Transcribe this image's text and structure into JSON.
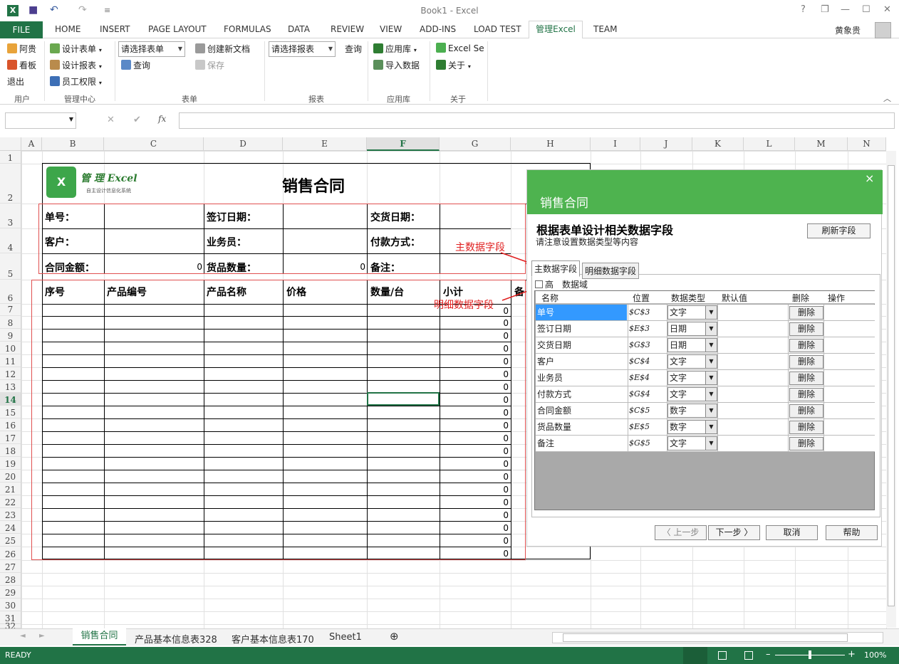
{
  "window": {
    "title": "Book1 - Excel",
    "help": "?",
    "restore_ribbon": "❐",
    "minimize": "—",
    "maximize": "☐",
    "close": "✕"
  },
  "qat": {
    "save": "■",
    "undo": "↶",
    "redo": "↷",
    "customize": "≡"
  },
  "tabs": {
    "file": "FILE",
    "home": "HOME",
    "insert": "INSERT",
    "page_layout": "PAGE LAYOUT",
    "formulas": "FORMULAS",
    "data": "DATA",
    "review": "REVIEW",
    "view": "VIEW",
    "add_ins": "ADD-INS",
    "load_test": "LOAD TEST",
    "manage_excel": "管理Excel",
    "team": "TEAM",
    "user": "黄象贵"
  },
  "ribbon": {
    "user_group": {
      "user": "阿贵",
      "dashboard": "看板",
      "logout": "退出",
      "label": "用户"
    },
    "mgmt_group": {
      "design_form": "设计表单",
      "design_report": "设计报表",
      "permissions": "员工权限",
      "label": "管理中心"
    },
    "form_group": {
      "select_form": "请选择表单",
      "query": "查询",
      "create_doc": "创建新文档",
      "save": "保存",
      "label": "表单"
    },
    "report_group": {
      "select_report": "请选择报表",
      "query": "查询",
      "label": "报表"
    },
    "app_group": {
      "app_lib": "应用库",
      "import": "导入数据",
      "label": "应用库"
    },
    "about_group": {
      "excel_se": "Excel Se",
      "about": "关于",
      "label": "关于"
    }
  },
  "formula_bar": {
    "cancel": "✕",
    "enter": "✔",
    "fx": "fx",
    "value": ""
  },
  "columns": [
    "A",
    "B",
    "C",
    "D",
    "E",
    "F",
    "G",
    "H",
    "I",
    "J",
    "K",
    "L",
    "M",
    "N"
  ],
  "rows": [
    "1",
    "2",
    "3",
    "4",
    "5",
    "6",
    "7",
    "8",
    "9",
    "10",
    "11",
    "12",
    "13",
    "14",
    "15",
    "16",
    "17",
    "18",
    "19",
    "20",
    "21",
    "22",
    "23",
    "24",
    "25",
    "26",
    "27",
    "28",
    "29",
    "30",
    "31",
    "32"
  ],
  "sheet": {
    "logo_title": "管 理 Excel",
    "logo_subtitle": "自主设计信息化系统",
    "title": "销售合同",
    "labels": {
      "order_no": "单号：",
      "sign_date": "签订日期：",
      "delivery_date": "交货日期：",
      "customer": "客户：",
      "salesman": "业务员：",
      "payment": "付款方式：",
      "amount": "合同金额：",
      "amount_val": "0",
      "qty": "货品数量：",
      "qty_val": "0",
      "remark": "备注："
    },
    "detail_headers": [
      "序号",
      "产品编号",
      "产品名称",
      "价格",
      "数量/台",
      "小计",
      "备"
    ],
    "subtotals": [
      "0",
      "0",
      "0",
      "0",
      "0",
      "0",
      "0",
      "0",
      "0",
      "0",
      "0",
      "0",
      "0",
      "0",
      "0",
      "0",
      "0",
      "0",
      "0",
      "0"
    ]
  },
  "dialog": {
    "title": "销售合同",
    "close": "×",
    "heading": "根据表单设计相关数据字段",
    "subheading": "请注意设置数据类型等内容",
    "refresh": "刷新字段",
    "tab_master": "主数据字段",
    "tab_detail": "明细数据字段",
    "advanced_prefix": "高",
    "advanced_suffix": "数据域",
    "headers": [
      "名称",
      "位置",
      "数据类型",
      "默认值",
      "删除",
      "操作"
    ],
    "fields": [
      {
        "name": "单号",
        "pos": "$C$3",
        "type": "文字",
        "del": "删除"
      },
      {
        "name": "签订日期",
        "pos": "$E$3",
        "type": "日期",
        "del": "删除"
      },
      {
        "name": "交货日期",
        "pos": "$G$3",
        "type": "日期",
        "del": "删除"
      },
      {
        "name": "客户",
        "pos": "$C$4",
        "type": "文字",
        "del": "删除"
      },
      {
        "name": "业务员",
        "pos": "$E$4",
        "type": "文字",
        "del": "删除"
      },
      {
        "name": "付款方式",
        "pos": "$G$4",
        "type": "文字",
        "del": "删除"
      },
      {
        "name": "合同金额",
        "pos": "$C$5",
        "type": "数字",
        "del": "删除"
      },
      {
        "name": "货品数量",
        "pos": "$E$5",
        "type": "数字",
        "del": "删除"
      },
      {
        "name": "备注",
        "pos": "$G$5",
        "type": "文字",
        "del": "删除"
      }
    ],
    "prev": "〈 上一步",
    "next": "下一步 〉",
    "cancel": "取消",
    "help": "帮助"
  },
  "annotations": {
    "master": "主数据字段",
    "detail": "明细数据字段"
  },
  "sheet_tabs": [
    "销售合同",
    "产品基本信息表328",
    "客户基本信息表170",
    "Sheet1"
  ],
  "add_sheet": "⊕",
  "status": {
    "ready": "READY",
    "zoom": "100%"
  },
  "colors": {
    "excel_green": "#217346",
    "dialog_green": "#4eb34f",
    "annotation_red": "#e02020"
  }
}
